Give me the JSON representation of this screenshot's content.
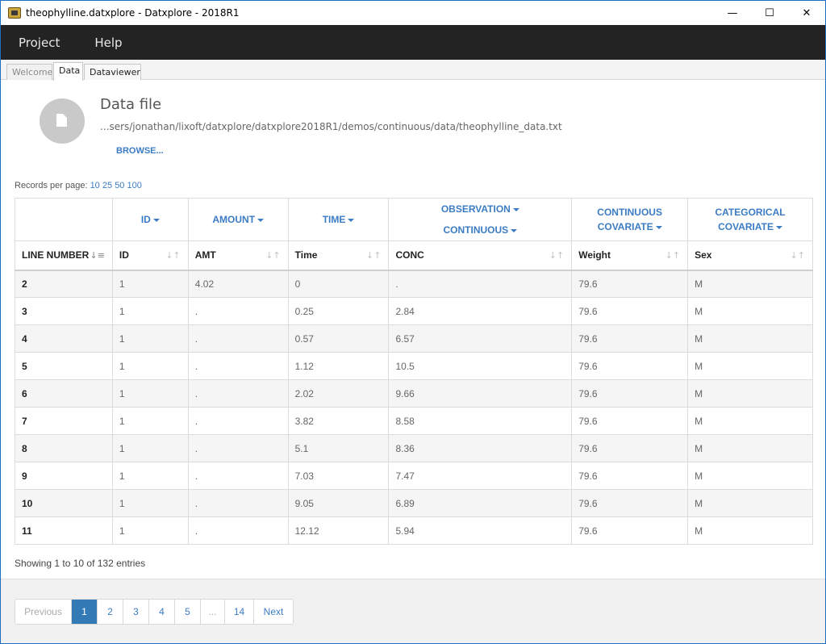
{
  "window": {
    "title": "theophylline.datxplore - Datxplore - 2018R1",
    "controls": {
      "minimize": "—",
      "maximize": "☐",
      "close": "✕"
    }
  },
  "menu": {
    "items": [
      "Project",
      "Help"
    ]
  },
  "tabs": [
    {
      "label": "Welcome",
      "state": "inactive"
    },
    {
      "label": "Data",
      "state": "active"
    },
    {
      "label": "Dataviewer",
      "state": "inactive"
    }
  ],
  "data_file": {
    "title": "Data file",
    "path": "...sers/jonathan/lixoft/datxplore/datxplore2018R1/demos/continuous/data/theophylline_data.txt",
    "browse_label": "BROWSE..."
  },
  "records_per_page": {
    "label": "Records per page:",
    "options": [
      "10",
      "25",
      "50",
      "100"
    ]
  },
  "table": {
    "type_headers": [
      {
        "lines": []
      },
      {
        "lines": [
          "ID"
        ]
      },
      {
        "lines": [
          "AMOUNT"
        ]
      },
      {
        "lines": [
          "TIME"
        ]
      },
      {
        "lines": [
          "OBSERVATION",
          "CONTINUOUS"
        ]
      },
      {
        "lines": [
          "CONTINUOUS",
          "COVARIATE"
        ]
      },
      {
        "lines": [
          "CATEGORICAL",
          "COVARIATE"
        ]
      }
    ],
    "columns": [
      "LINE NUMBER",
      "ID",
      "AMT",
      "Time",
      "CONC",
      "Weight",
      "Sex"
    ],
    "rows": [
      [
        "2",
        "1",
        "4.02",
        "0",
        ".",
        "79.6",
        "M"
      ],
      [
        "3",
        "1",
        ".",
        "0.25",
        "2.84",
        "79.6",
        "M"
      ],
      [
        "4",
        "1",
        ".",
        "0.57",
        "6.57",
        "79.6",
        "M"
      ],
      [
        "5",
        "1",
        ".",
        "1.12",
        "10.5",
        "79.6",
        "M"
      ],
      [
        "6",
        "1",
        ".",
        "2.02",
        "9.66",
        "79.6",
        "M"
      ],
      [
        "7",
        "1",
        ".",
        "3.82",
        "8.58",
        "79.6",
        "M"
      ],
      [
        "8",
        "1",
        ".",
        "5.1",
        "8.36",
        "79.6",
        "M"
      ],
      [
        "9",
        "1",
        ".",
        "7.03",
        "7.47",
        "79.6",
        "M"
      ],
      [
        "10",
        "1",
        ".",
        "9.05",
        "6.89",
        "79.6",
        "M"
      ],
      [
        "11",
        "1",
        ".",
        "12.12",
        "5.94",
        "79.6",
        "M"
      ]
    ]
  },
  "showing_text": "Showing 1 to 10 of 132 entries",
  "pagination": {
    "previous": "Previous",
    "pages": [
      "1",
      "2",
      "3",
      "4",
      "5",
      "...",
      "14"
    ],
    "current": "1",
    "next": "Next"
  },
  "colors": {
    "accent": "#3b7cc4",
    "menubar": "#232323",
    "active_page": "#337ab7"
  }
}
